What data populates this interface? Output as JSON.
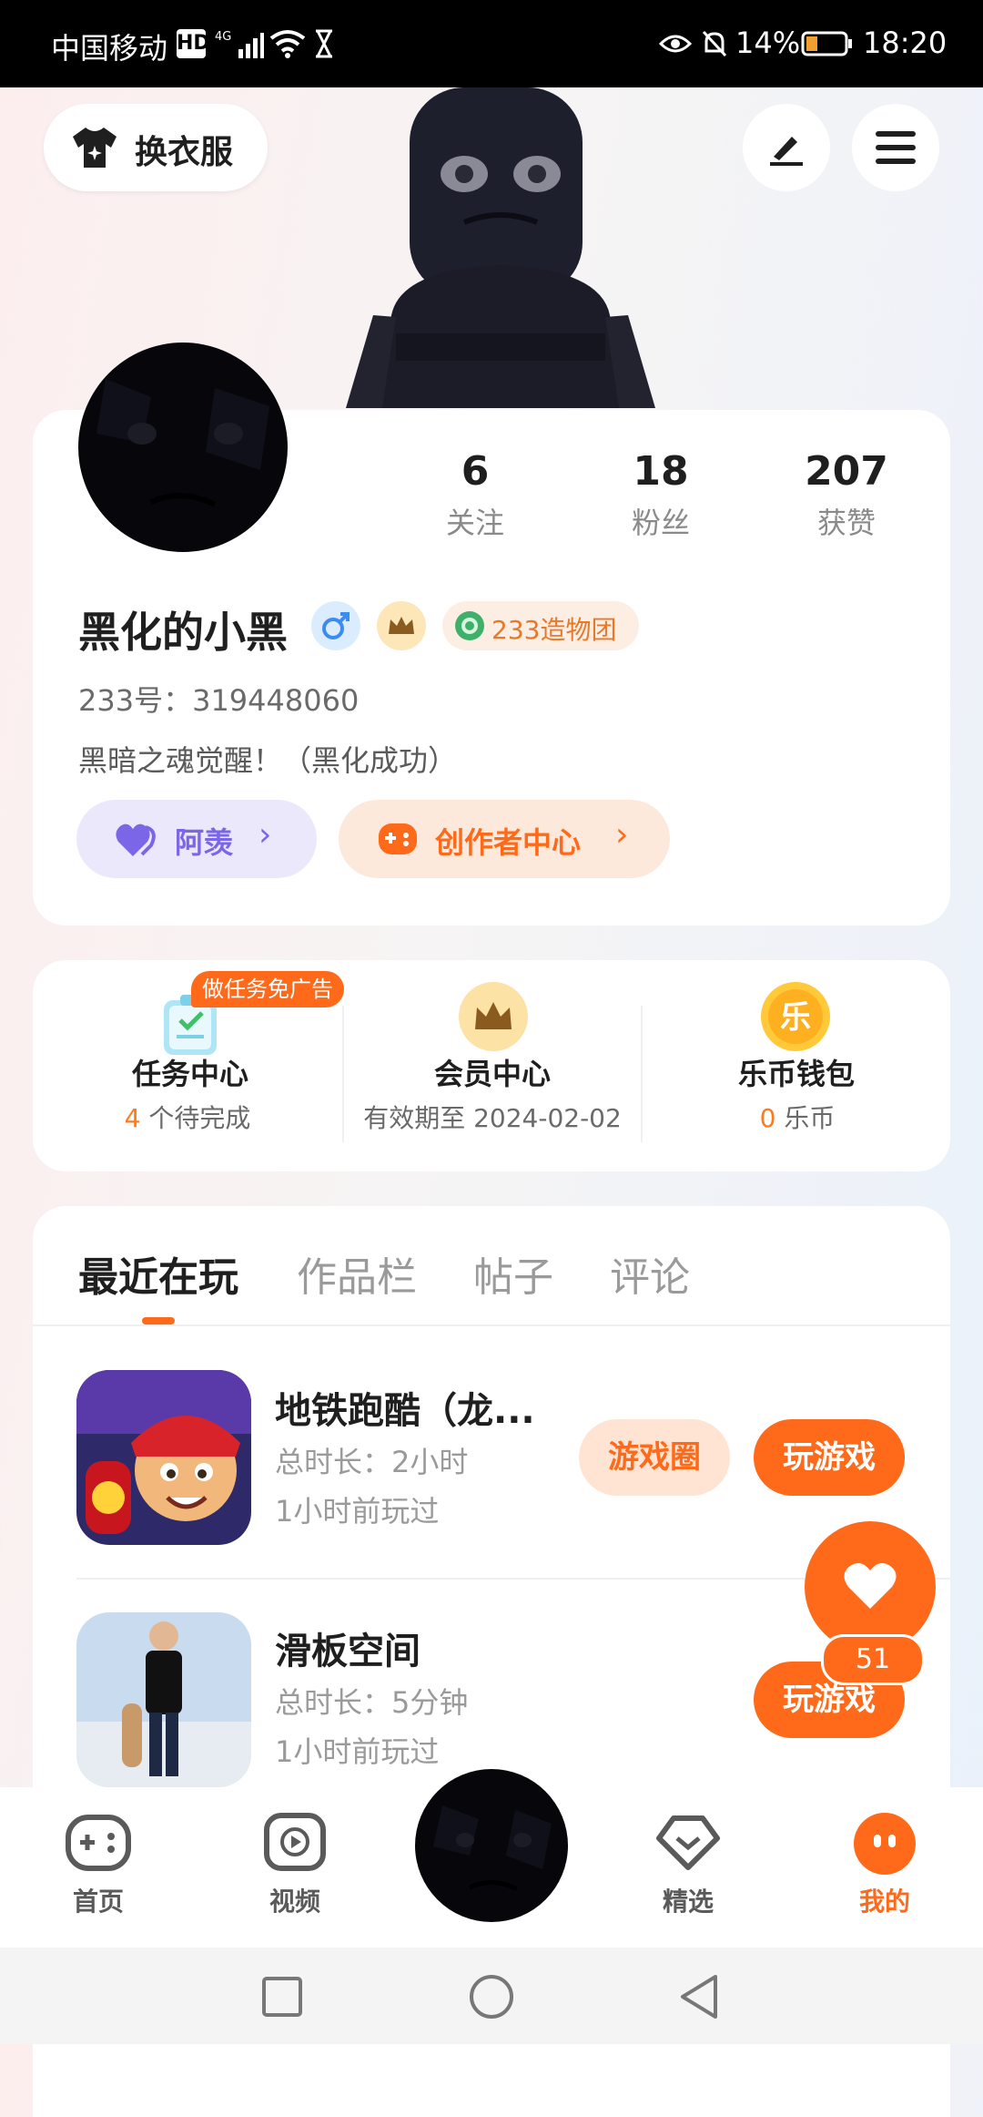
{
  "status_bar": {
    "carrier": "中国移动",
    "battery": "14%",
    "time": "18:20"
  },
  "top": {
    "outfit_button": "换衣服"
  },
  "profile": {
    "stats": [
      {
        "value": "6",
        "label": "关注"
      },
      {
        "value": "18",
        "label": "粉丝"
      },
      {
        "value": "207",
        "label": "获赞"
      }
    ],
    "name": "黑化的小黑",
    "group_badge": "233造物团",
    "id_line": "233号：319448060",
    "bio": "黑暗之魂觉醒！（黑化成功）",
    "pill_1": "阿羡",
    "pill_2": "创作者中心"
  },
  "services": {
    "ad_badge": "做任务免广告",
    "items": [
      {
        "title": "任务中心",
        "num": "4",
        "sub": " 个待完成"
      },
      {
        "title": "会员中心",
        "num": "",
        "sub": "有效期至 2024-02-02"
      },
      {
        "title": "乐币钱包",
        "num": "0",
        "sub": " 乐币"
      }
    ],
    "coin_glyph": "乐"
  },
  "tabs": [
    "最近在玩",
    "作品栏",
    "帖子",
    "评论"
  ],
  "games": [
    {
      "title": "地铁跑酷（龙...",
      "duration": "总时长：2小时",
      "last": "1小时前玩过",
      "circle_btn": "游戏圈",
      "play_btn": "玩游戏"
    },
    {
      "title": "滑板空间",
      "duration": "总时长：5分钟",
      "last": "1小时前玩过",
      "play_btn": "玩游戏"
    }
  ],
  "floating_like": {
    "count": "51"
  },
  "bottom_nav": [
    "首页",
    "视频",
    "精选",
    "我的"
  ],
  "colors": {
    "accent": "#ff6a1a",
    "purple": "#7a66e6"
  }
}
